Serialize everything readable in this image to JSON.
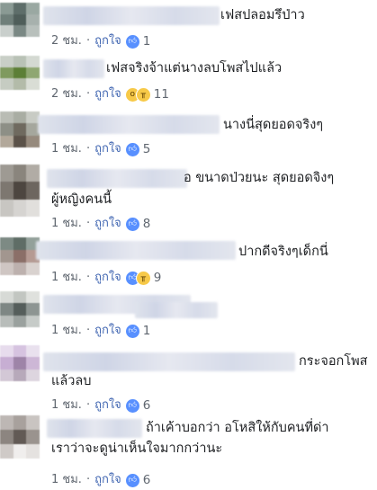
{
  "colors": {
    "link": "#4267b2",
    "meta": "#606770",
    "like": "#5890ff",
    "emoji": "#f7c948"
  },
  "comments": [
    {
      "text_lines": [
        "เฟสปลอมรึป่าว"
      ],
      "time": "2 ชม.",
      "like_label": "ถูกใจ",
      "reactions": [
        "like-icon"
      ],
      "count": "1"
    },
    {
      "text_lines": [
        "เฟสจริงจ้าแต่นางลบโพสไปแล้ว"
      ],
      "time": "2 ชม.",
      "like_label": "ถูกใจ",
      "reactions": [
        "wow-icon",
        "sad-icon"
      ],
      "count": "11"
    },
    {
      "text_lines": [
        "นางนี่สุดยอดจริงๆ"
      ],
      "time": "1 ชม.",
      "like_label": "ถูกใจ",
      "reactions": [
        "like-icon"
      ],
      "count": "5"
    },
    {
      "text_lines": [
        "อ ขนาดป่วยนะ สุดยอดจิงๆ",
        "ผู้หญิงคนนี้"
      ],
      "time": "1 ชม.",
      "like_label": "ถูกใจ",
      "reactions": [
        "like-icon"
      ],
      "count": "8"
    },
    {
      "text_lines": [
        "ปากดีจริงๆเด็กนี่"
      ],
      "time": "1 ชม.",
      "like_label": "ถูกใจ",
      "reactions": [
        "like-icon",
        "sad-icon"
      ],
      "count": "9"
    },
    {
      "text_lines": [
        ""
      ],
      "time": "1 ชม.",
      "like_label": "ถูกใจ",
      "reactions": [
        "like-icon"
      ],
      "count": "1"
    },
    {
      "text_lines": [
        "กระจอกโพส",
        "แล้วลบ"
      ],
      "time": "1 ชม.",
      "like_label": "ถูกใจ",
      "reactions": [
        "like-icon"
      ],
      "count": "6"
    },
    {
      "text_lines": [
        "ถ้าเค้าบอกว่า อโหสิให้กับคนที่ด่า",
        "เราว่าจะดูน่าเห็นใจมากกว่านะ"
      ],
      "time": "1 ชม.",
      "like_label": "ถูกใจ",
      "reactions": [
        "like-icon"
      ],
      "count": "6"
    }
  ]
}
